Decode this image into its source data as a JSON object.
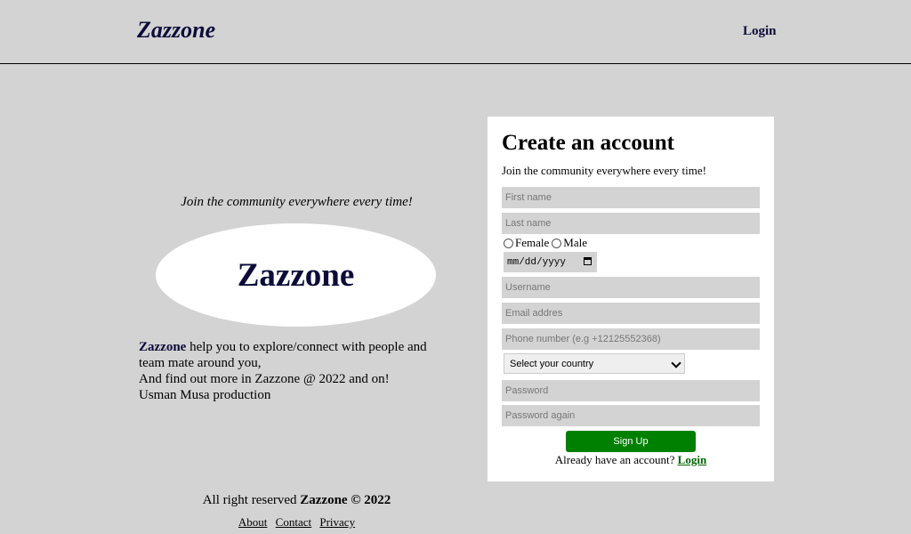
{
  "header": {
    "brand": "Zazzone",
    "login_label": "Login"
  },
  "hero": {
    "tagline": "Join the community everywhere every time!",
    "logo_text": "Zazzone",
    "brand_bold": "Zazzone",
    "line1_rest": " help you to explore/connect with people and team mate around you,",
    "line2": "And find out more in Zazzone @ 2022 and on!",
    "line3": "Usman Musa production"
  },
  "signup_form": {
    "title": "Create an account",
    "subtitle": "Join the community everywhere every time!",
    "first_name_placeholder": "First name",
    "last_name_placeholder": "Last name",
    "gender_female": "Female",
    "gender_male": "Male",
    "date_placeholder": "mm/dd/yyyy",
    "username_placeholder": "Username",
    "email_placeholder": "Email addres",
    "phone_placeholder": "Phone number (e.g +12125552368)",
    "country_selected": "Select your country",
    "password_placeholder": "Password",
    "password_again_placeholder": "Password again",
    "signup_label": "Sign Up",
    "have_account_text": "Already have an account? ",
    "login_link": "Login",
    "button_color": "#008000"
  },
  "footer": {
    "rights_text": "All right reserved ",
    "rights_brand": "Zazzone © 2022",
    "links": [
      "About",
      "Contact",
      "Privacy"
    ]
  }
}
